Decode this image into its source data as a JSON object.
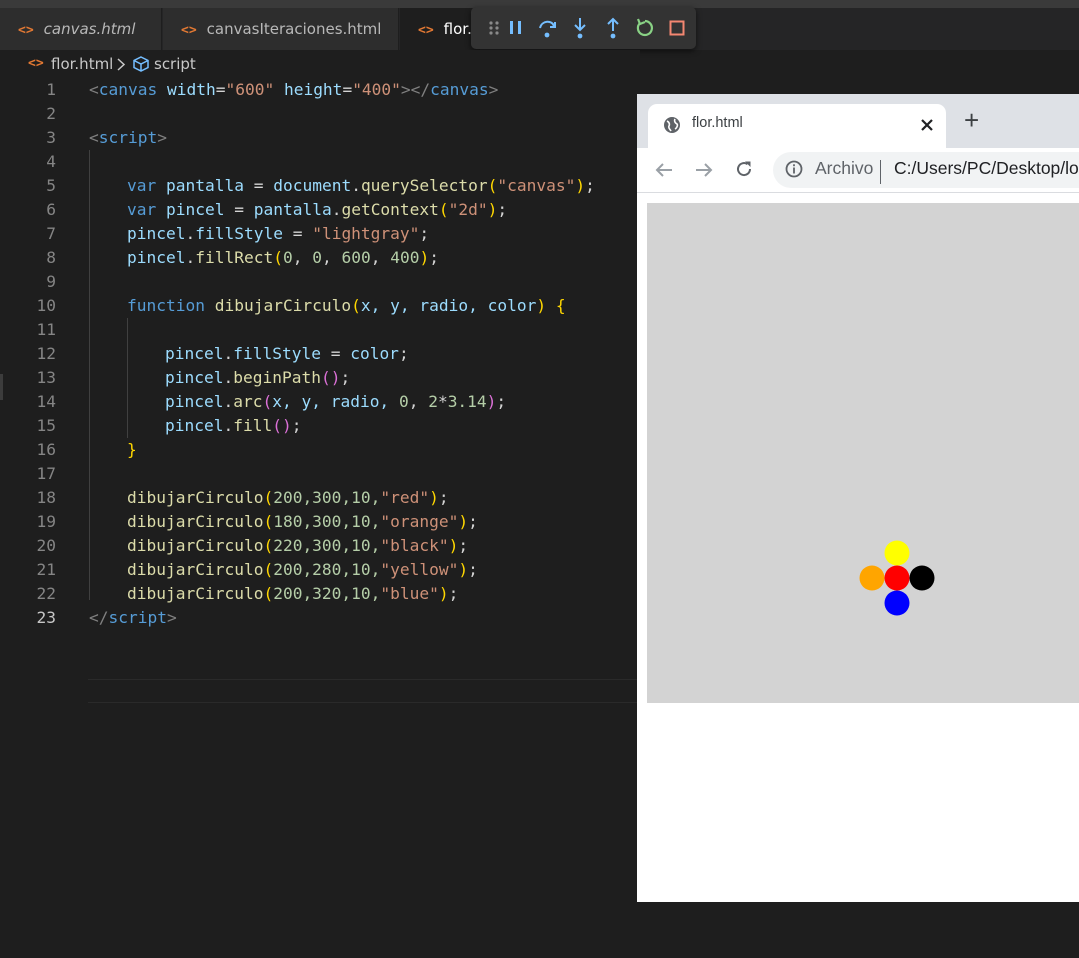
{
  "editor": {
    "tabs": [
      {
        "label": "canvas.html",
        "icon": "html-file-icon",
        "italic": true
      },
      {
        "label": "canvasIteraciones.html",
        "icon": "html-file-icon",
        "italic": false
      },
      {
        "label": "flor.h",
        "icon": "html-file-icon",
        "italic": false,
        "active": true
      }
    ],
    "debug_toolbar": [
      "drag-handle-icon",
      "pause-icon",
      "step-over-icon",
      "step-into-icon",
      "step-out-icon",
      "restart-icon",
      "stop-icon"
    ],
    "breadcrumb": {
      "file": "flor.html",
      "symbol": "script"
    },
    "line_numbers": [
      "1",
      "2",
      "3",
      "4",
      "5",
      "6",
      "7",
      "8",
      "9",
      "10",
      "11",
      "12",
      "13",
      "14",
      "15",
      "16",
      "17",
      "18",
      "19",
      "20",
      "21",
      "22",
      "23"
    ],
    "current_line": "23",
    "code": {
      "l1": {
        "lt": "<",
        "el": "canvas",
        "a1": "width",
        "eq1": "=",
        "v1": "\"600\"",
        "a2": "height",
        "eq2": "=",
        "v2": "\"400\"",
        "gt": ">",
        "close_open": "</",
        "el2": "canvas",
        "gt2": ">"
      },
      "l3": {
        "lt": "<",
        "el": "script",
        "gt": ">"
      },
      "l5": {
        "kw": "var",
        "name": "pantalla",
        "eq": "=",
        "obj": "document",
        "dot": ".",
        "fn": "querySelector",
        "p1": "(",
        "str": "\"canvas\"",
        "p2": ")",
        "semi": ";"
      },
      "l6": {
        "kw": "var",
        "name": "pincel",
        "eq": "=",
        "obj": "pantalla",
        "dot": ".",
        "fn": "getContext",
        "p1": "(",
        "str": "\"2d\"",
        "p2": ")",
        "semi": ";"
      },
      "l7": {
        "obj": "pincel",
        "dot": ".",
        "prop": "fillStyle",
        "eq": "=",
        "str": "\"lightgray\"",
        "semi": ";"
      },
      "l8": {
        "obj": "pincel",
        "dot": ".",
        "fn": "fillRect",
        "p1": "(",
        "n1": "0",
        "c1": ", ",
        "n2": "0",
        "c2": ", ",
        "n3": "600",
        "c3": ", ",
        "n4": "400",
        "p2": ")",
        "semi": ";"
      },
      "l10": {
        "kw": "function",
        "fn": "dibujarCirculo",
        "p1": "(",
        "args": "x, y, radio, color",
        "p2": ")",
        "brace": "{"
      },
      "l12": {
        "obj": "pincel",
        "dot": ".",
        "prop": "fillStyle",
        "eq": "=",
        "val": "color",
        "semi": ";"
      },
      "l13": {
        "obj": "pincel",
        "dot": ".",
        "fn": "beginPath",
        "parens": "()",
        "semi": ";"
      },
      "l14": {
        "obj": "pincel",
        "dot": ".",
        "fn": "arc",
        "p1": "(",
        "a": "x, y, radio, ",
        "n1": "0",
        "c": ", ",
        "n2": "2",
        "op": "*",
        "n3": "3.14",
        "p2": ")",
        "semi": ";"
      },
      "l15": {
        "obj": "pincel",
        "dot": ".",
        "fn": "fill",
        "parens": "()",
        "semi": ";"
      },
      "l16": {
        "brace": "}"
      },
      "l18": {
        "fn": "dibujarCirculo",
        "p1": "(",
        "nums": "200,300,10,",
        "str": "\"red\"",
        "p2": ")",
        "semi": ";"
      },
      "l19": {
        "fn": "dibujarCirculo",
        "p1": "(",
        "nums": "180,300,10,",
        "str": "\"orange\"",
        "p2": ")",
        "semi": ";"
      },
      "l20": {
        "fn": "dibujarCirculo",
        "p1": "(",
        "nums": "220,300,10,",
        "str": "\"black\"",
        "p2": ")",
        "semi": ";"
      },
      "l21": {
        "fn": "dibujarCirculo",
        "p1": "(",
        "nums": "200,280,10,",
        "str": "\"yellow\"",
        "p2": ")",
        "semi": ";"
      },
      "l22": {
        "fn": "dibujarCirculo",
        "p1": "(",
        "nums": "200,320,10,",
        "str": "\"blue\"",
        "p2": ")",
        "semi": ";"
      },
      "l23": {
        "lt": "</",
        "el": "script",
        "gt": ">"
      }
    }
  },
  "browser": {
    "tab_title": "flor.html",
    "new_tab_label": "+",
    "address": {
      "info_label": "Archivo",
      "url": "C:/Users/PC/Desktop/lo"
    },
    "canvas": {
      "background": "#d3d3d3",
      "circles": [
        {
          "color": "#ff0000",
          "label": "red"
        },
        {
          "color": "#ffa500",
          "label": "orange"
        },
        {
          "color": "#000000",
          "label": "black"
        },
        {
          "color": "#ffff00",
          "label": "yellow"
        },
        {
          "color": "#0000ff",
          "label": "blue"
        }
      ]
    }
  },
  "colors": {
    "editor_bg": "#1e1e1e",
    "tab_icon": "#e37933",
    "debug_blue": "#75beff",
    "debug_green": "#89d185",
    "debug_stop": "#f48771"
  }
}
